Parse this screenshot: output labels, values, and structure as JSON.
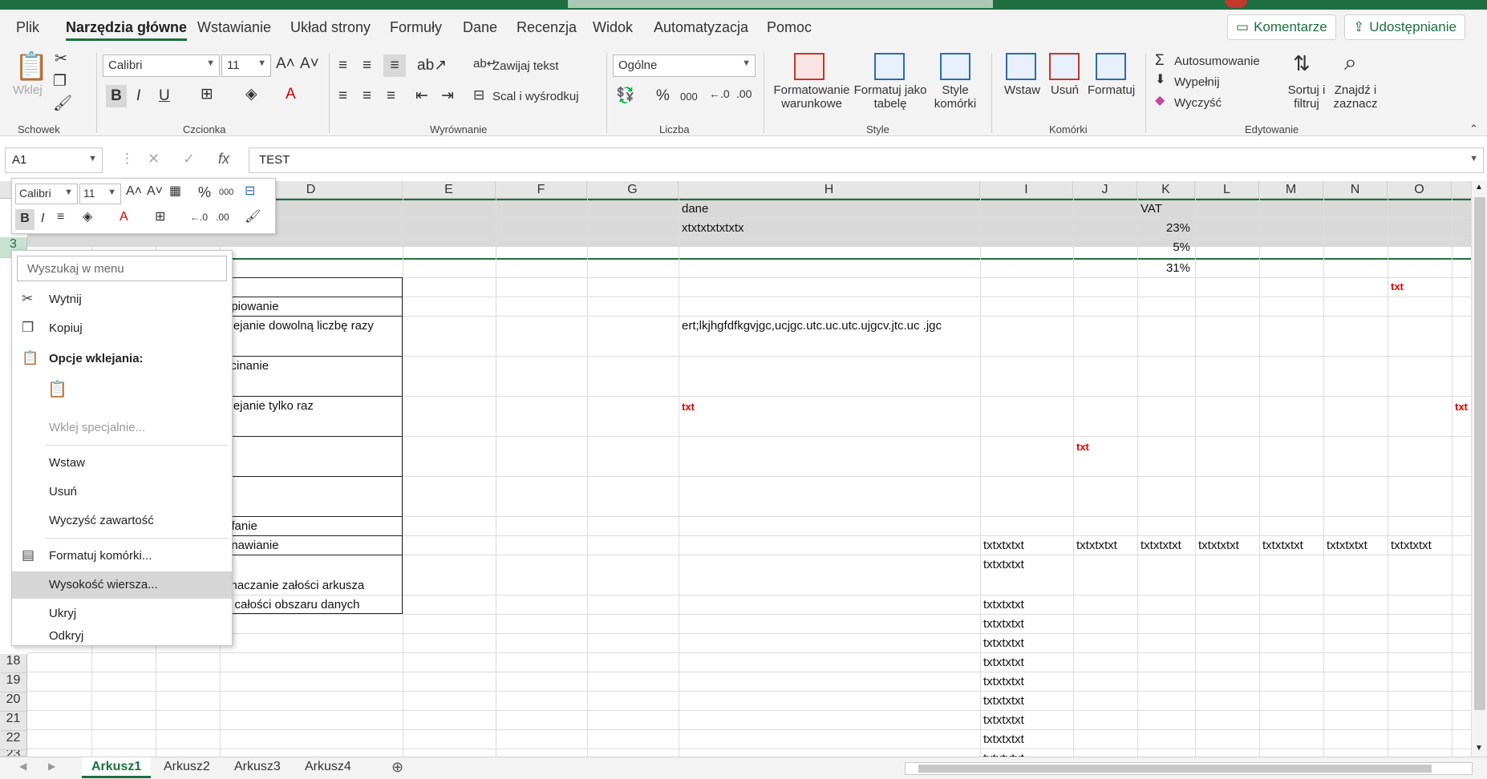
{
  "tabs": [
    "Plik",
    "Narzędzia główne",
    "Wstawianie",
    "Układ strony",
    "Formuły",
    "Dane",
    "Recenzja",
    "Widok",
    "Automatyzacja",
    "Pomoc"
  ],
  "top_buttons": {
    "comments": "Komentarze",
    "share": "Udostępnianie"
  },
  "ribbon": {
    "clipboard": {
      "paste": "Wklej",
      "group": "Schowek"
    },
    "font": {
      "name": "Calibri",
      "size": "11",
      "group": "Czcionka"
    },
    "alignment": {
      "wrap": "Zawijaj tekst",
      "merge": "Scal i wyśrodkuj",
      "group": "Wyrównanie"
    },
    "number": {
      "format": "Ogólne",
      "group": "Liczba"
    },
    "styles": {
      "conditional": [
        "Formatowanie",
        "warunkowe"
      ],
      "table": [
        "Formatuj jako",
        "tabelę"
      ],
      "cell": [
        "Style",
        "komórki"
      ],
      "group": "Style"
    },
    "cells": {
      "insert": "Wstaw",
      "delete": "Usuń",
      "format": "Formatuj",
      "group": "Komórki"
    },
    "editing": {
      "autosum": "Autosumowanie",
      "fill": "Wypełnij",
      "clear": "Wyczyść",
      "sort": [
        "Sortuj i",
        "filtruj"
      ],
      "find": [
        "Znajdź i",
        "zaznacz"
      ],
      "group": "Edytowanie"
    }
  },
  "formula_bar": {
    "name_box": "A1",
    "formula": "TEST"
  },
  "columns": [
    "D",
    "E",
    "F",
    "G",
    "H",
    "I",
    "J",
    "K",
    "L",
    "M",
    "N",
    "O"
  ],
  "rows": [
    "3",
    "18",
    "19",
    "20",
    "21",
    "22",
    "23"
  ],
  "cells": {
    "h_dane": "dane",
    "h_x": "xtxtxtxtxtxtx",
    "k_vat": "VAT",
    "k_23": "23%",
    "k_5": "5%",
    "k_31": "31%",
    "o_txt": "txt",
    "d_kop": "opiowanie",
    "d_wkl_dow": "klejanie dowolną liczbę razy",
    "h_long": "ert;lkjhgfdfkgvjgc,ucjgc.utc.uc.utc.ujgcv.jtc.uc .jgc",
    "d_wyc": "ycinanie",
    "d_wkl_raz": "klejanie tylko raz",
    "h_txt": "txt",
    "p_txt": "txt",
    "j_txt": "txt",
    "d_cof": "ofanie",
    "d_pon": "onawianie",
    "d_zazn1": "znaczanie załości arkusza",
    "d_zazn2": "b całości obszaru danych",
    "txt8": "txtxtxtxt"
  },
  "context_menu": {
    "search_placeholder": "Wyszukaj w menu",
    "items": [
      "Wytnij",
      "Kopiuj",
      "Opcje wklejania:",
      "Wklej specjalnie...",
      "Wstaw",
      "Usuń",
      "Wyczyść zawartość",
      "Formatuj komórki...",
      "Wysokość wiersza...",
      "Ukryj",
      "Odkryj"
    ]
  },
  "sheets": [
    "Arkusz1",
    "Arkusz2",
    "Arkusz3",
    "Arkusz4"
  ],
  "colors": {
    "accent": "#1e6e41",
    "red_text": "#e00000"
  }
}
